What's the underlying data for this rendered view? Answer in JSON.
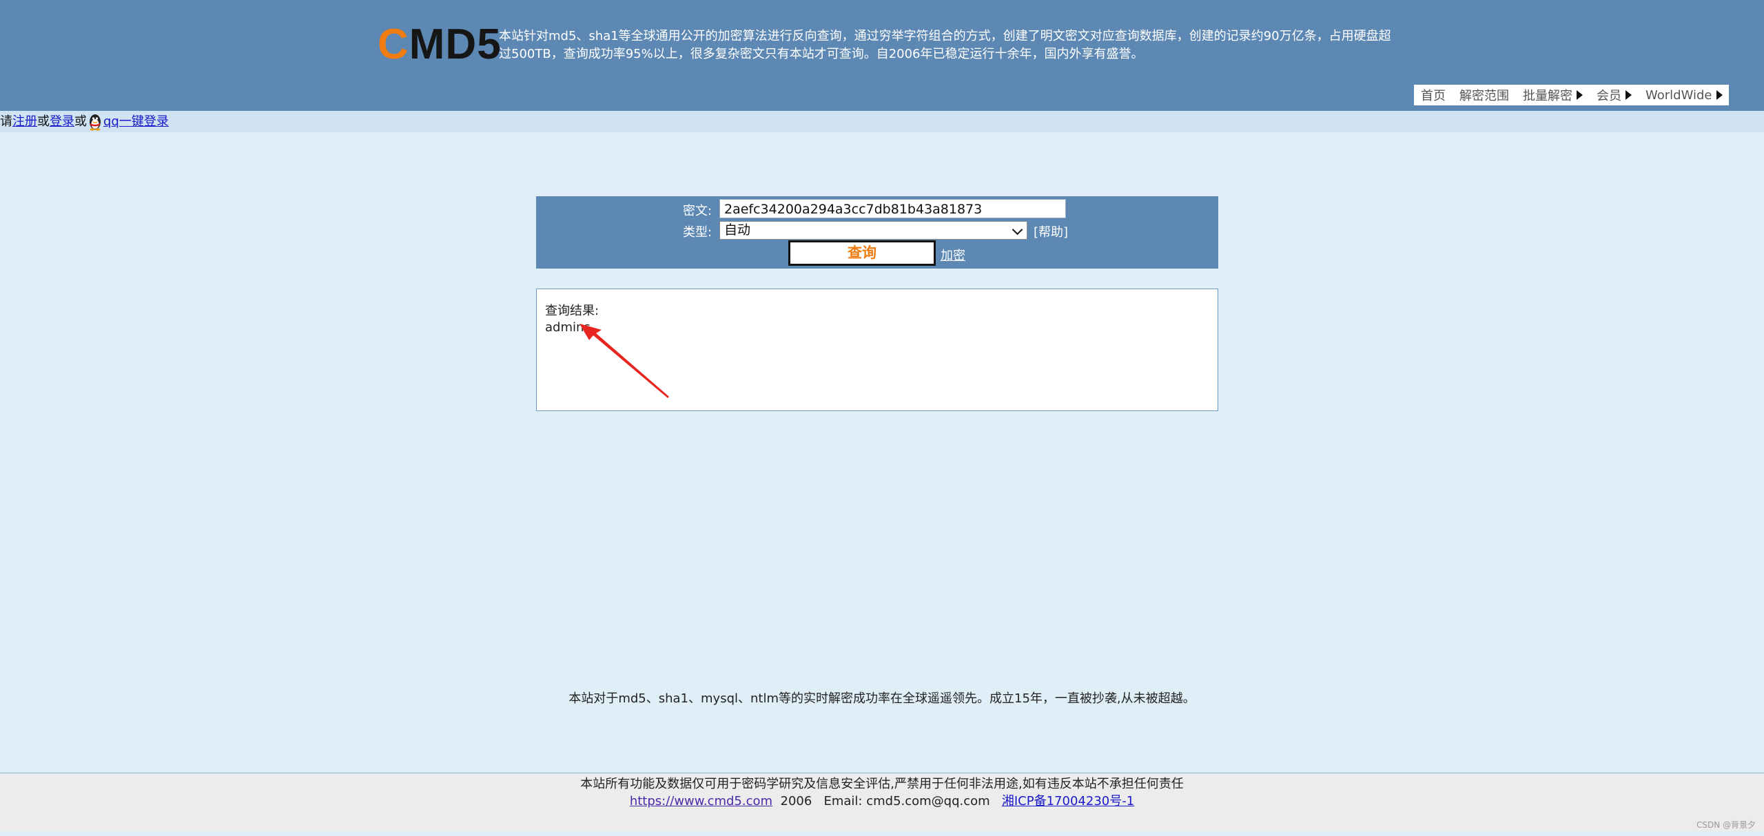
{
  "header": {
    "logo_c": "C",
    "logo_rest": "MD5",
    "intro": "本站针对md5、sha1等全球通用公开的加密算法进行反向查询，通过穷举字符组合的方式，创建了明文密文对应查询数据库，创建的记录约90万亿条，占用硬盘超过500TB，查询成功率95%以上，很多复杂密文只有本站才可查询。自2006年已稳定运行十余年，国内外享有盛誉。",
    "nav": [
      {
        "label": "首页",
        "has_arrow": false
      },
      {
        "label": "解密范围",
        "has_arrow": false
      },
      {
        "label": "批量解密",
        "has_arrow": true
      },
      {
        "label": "会员",
        "has_arrow": true
      },
      {
        "label": "WorldWide",
        "has_arrow": true
      }
    ]
  },
  "loginbar": {
    "prefix": "请",
    "register": "注册",
    "or1": "或",
    "login": "登录",
    "or2": "或",
    "qq_login": "qq一键登录"
  },
  "search": {
    "cipher_label": "密文:",
    "cipher_value": "2aefc34200a294a3cc7db81b43a81873",
    "type_label": "类型:",
    "type_value": "自动",
    "help": "[帮助]",
    "query_button": "查询",
    "encrypt_link": "加密"
  },
  "result": {
    "label": "查询结果:",
    "value": "admins"
  },
  "slogan": "本站对于md5、sha1、mysql、ntlm等的实时解密成功率在全球遥遥领先。成立15年，一直被抄袭,从未被超越。",
  "footer": {
    "disclaimer": "本站所有功能及数据仅可用于密码学研究及信息安全评估,严禁用于任何非法用途,如有违反本站不承担任何责任",
    "url": "https://www.cmd5.com",
    "year": "2006",
    "email": "Email: cmd5.com@qq.com",
    "icp": "湘ICP备17004230号-1"
  },
  "watermark": "CSDN @背景夕",
  "colors": {
    "header_bg": "#5d88b3",
    "page_bg": "#dfeef7",
    "accent_orange": "#f07c12",
    "annotation_arrow": "#e8261f"
  },
  "icons": {
    "qq": "qq-penguin-icon",
    "nav_arrow": "triangle-right-icon",
    "select_arrow": "chevron-down-icon",
    "annotation": "red-arrow-annotation"
  }
}
